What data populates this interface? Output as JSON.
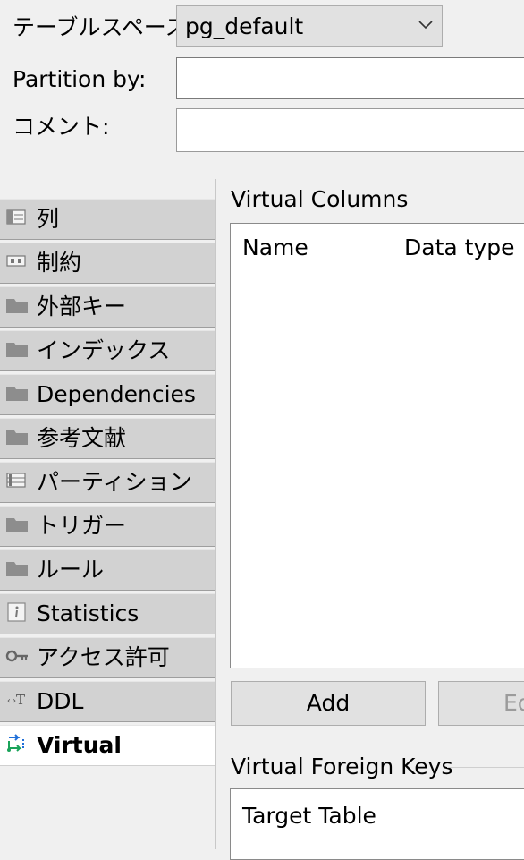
{
  "form": {
    "tablespace_label": "テーブルスペース:",
    "tablespace_value": "pg_default",
    "partition_label": "Partition by:",
    "partition_value": "",
    "comment_label": "コメント:",
    "comment_value": ""
  },
  "tabs": [
    {
      "label": "列",
      "icon": "columns-icon"
    },
    {
      "label": "制約",
      "icon": "key-icon"
    },
    {
      "label": "外部キー",
      "icon": "folder-icon"
    },
    {
      "label": "インデックス",
      "icon": "folder-icon"
    },
    {
      "label": "Dependencies",
      "icon": "folder-icon"
    },
    {
      "label": "参考文献",
      "icon": "folder-icon"
    },
    {
      "label": "パーティション",
      "icon": "partition-icon"
    },
    {
      "label": "トリガー",
      "icon": "folder-icon"
    },
    {
      "label": "ルール",
      "icon": "folder-icon"
    },
    {
      "label": "Statistics",
      "icon": "info-icon"
    },
    {
      "label": "アクセス許可",
      "icon": "permission-key-icon"
    },
    {
      "label": "DDL",
      "icon": "ddl-icon"
    },
    {
      "label": "Virtual",
      "icon": "virtual-icon",
      "active": true
    }
  ],
  "virtual_columns": {
    "title": "Virtual Columns",
    "columns": [
      "Name",
      "Data type"
    ],
    "add_label": "Add",
    "edit_label": "Edit"
  },
  "virtual_foreign_keys": {
    "title": "Virtual Foreign Keys",
    "columns": [
      "Target Table"
    ]
  },
  "colors": {
    "tab_bg": "#d2d2d2",
    "active_tab_bg": "#ffffff",
    "virtual_icon_blue": "#1f6fd8",
    "virtual_icon_green": "#1aa35a"
  }
}
